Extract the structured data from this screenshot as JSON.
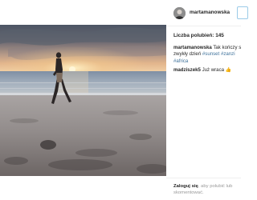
{
  "post": {
    "author": {
      "username": "martamanowska"
    },
    "likes_label": "Liczba polubień: 145",
    "caption": {
      "username": "martamanowska",
      "text_line1": "Tak kończy s",
      "text_line2": "zwykły dzień",
      "hashtags_line2": "#sunset #zanzi",
      "hashtags_line3": "#africa"
    },
    "comments": [
      {
        "username": "madziszek5",
        "text": "Już wraca",
        "emoji": "👍"
      }
    ],
    "login_prompt": {
      "link": "Zaloguj się",
      "text_line1": ", aby polubić lub",
      "text_line2": "skomentować."
    }
  },
  "colors": {
    "hashtag": "#3f729b",
    "muted": "#999999",
    "text": "#262626"
  }
}
